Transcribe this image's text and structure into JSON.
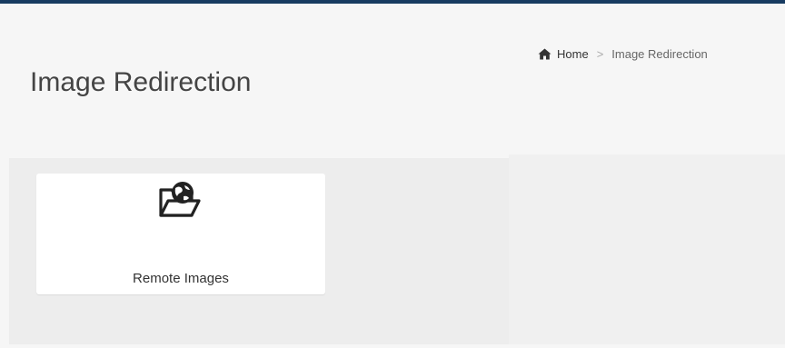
{
  "page": {
    "title": "Image Redirection"
  },
  "breadcrumb": {
    "home_label": "Home",
    "separator": ">",
    "current_label": "Image Redirection"
  },
  "tiles": [
    {
      "label": "Remote Images",
      "icon": "folder-globe-icon"
    }
  ],
  "colors": {
    "top_bar": "#173b61",
    "background": "#f6f6f6",
    "content_panel": "#ededed",
    "tile_background": "#ffffff"
  }
}
